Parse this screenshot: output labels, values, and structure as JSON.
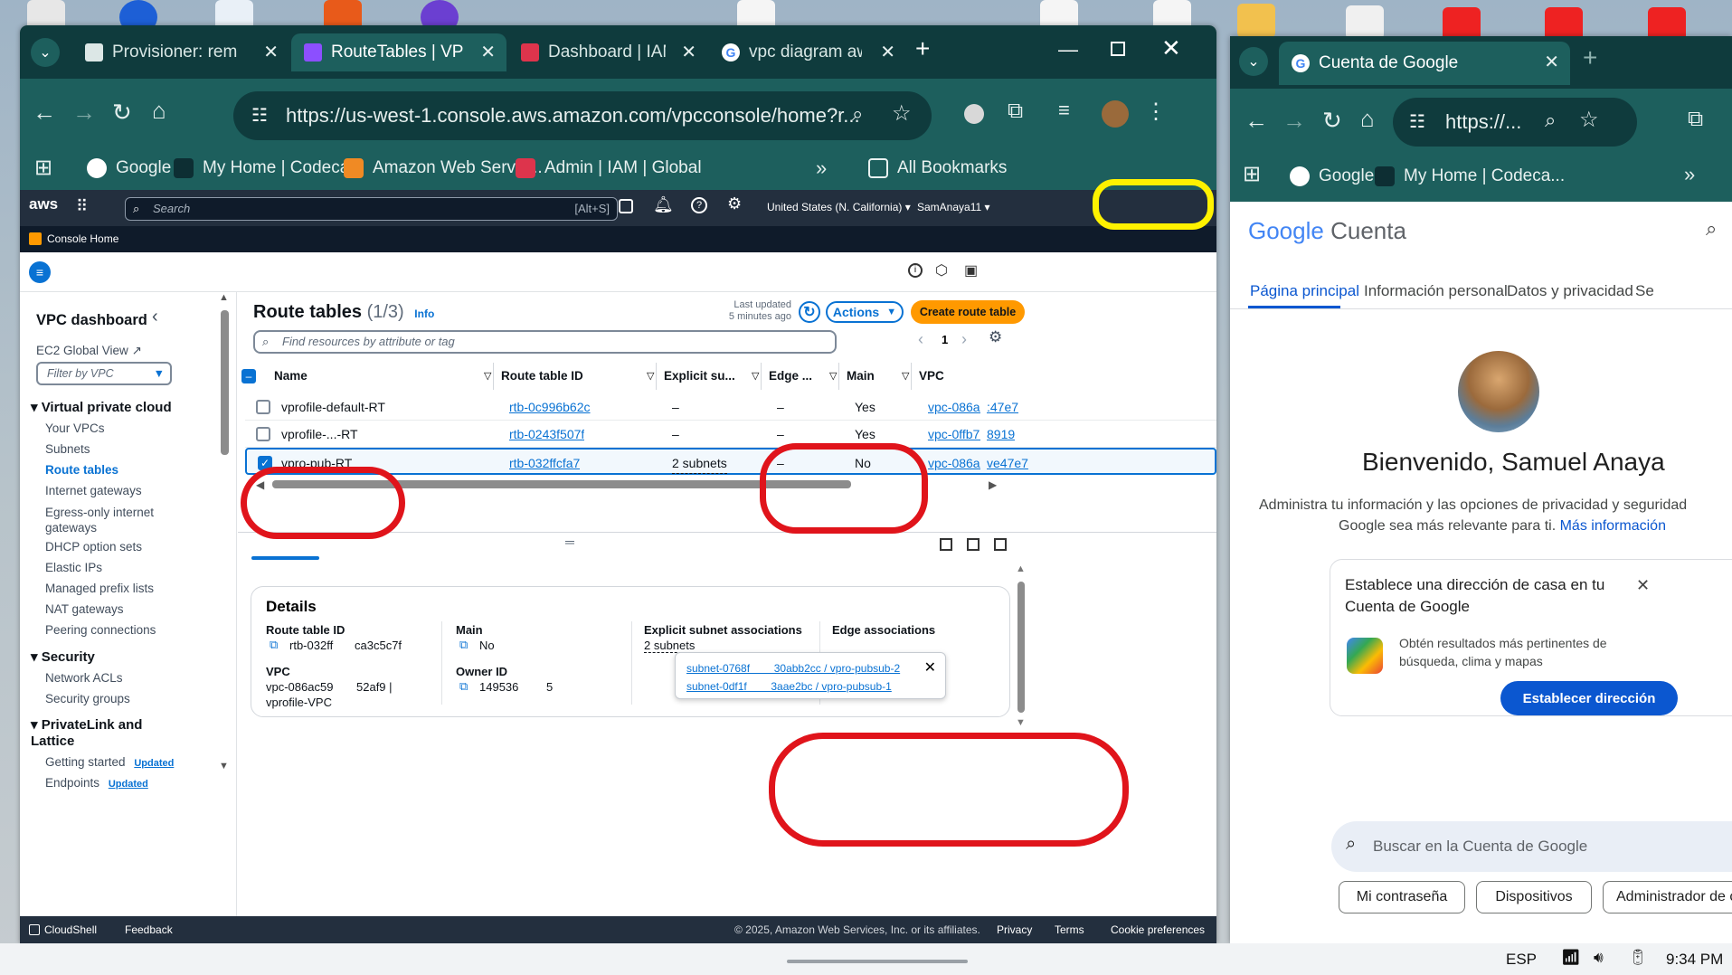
{
  "browser": {
    "tabs": [
      {
        "label": "Provisioner: rem"
      },
      {
        "label": "RouteTables | VP"
      },
      {
        "label": "Dashboard | IAM"
      },
      {
        "label": "vpc diagram aw"
      }
    ],
    "url": "https://us-west-1.console.aws.amazon.com/vpcconsole/home?r...",
    "bookmarks": [
      "Google",
      "My Home | Codeca...",
      "Amazon Web Servic...",
      "Admin | IAM | Global"
    ],
    "all_bookmarks": "All Bookmarks"
  },
  "aws": {
    "logo": "aws",
    "search_placeholder": "Search",
    "search_shortcut": "[Alt+S]",
    "region": "United States (N. California)",
    "user": "SamAnaya11",
    "console_home": "Console Home"
  },
  "sidebar": {
    "title": "VPC dashboard",
    "ec2_global": "EC2 Global View",
    "filter_placeholder": "Filter by VPC",
    "sections": [
      {
        "title": "Virtual private cloud",
        "items": [
          "Your VPCs",
          "Subnets",
          "Route tables",
          "Internet gateways",
          "Egress-only internet gateways",
          "DHCP option sets",
          "Elastic IPs",
          "Managed prefix lists",
          "NAT gateways",
          "Peering connections"
        ]
      },
      {
        "title": "Security",
        "items": [
          "Network ACLs",
          "Security groups"
        ]
      },
      {
        "title": "PrivateLink and Lattice",
        "items": [
          "Getting started",
          "Endpoints"
        ]
      }
    ],
    "updated_badge": "Updated"
  },
  "route_tables": {
    "title": "Route tables",
    "count": "(1/3)",
    "info": "Info",
    "last_updated": "Last updated",
    "last_updated_when": "5 minutes ago",
    "actions": "Actions",
    "create": "Create route table",
    "filter_placeholder": "Find resources by attribute or tag",
    "page": "1",
    "columns": [
      "Name",
      "Route table ID",
      "Explicit su...",
      "Edge ...",
      "Main",
      "VPC"
    ],
    "rows": [
      {
        "name": "vprofile-default-RT",
        "id": "rtb-0c996b62c",
        "explicit": "–",
        "edge": "–",
        "main": "Yes",
        "vpc": "vpc-086ac",
        "vpc2": ":47e7"
      },
      {
        "name": "vprofile-...-RT",
        "id": "rtb-0243f507f",
        "explicit": "–",
        "edge": "–",
        "main": "Yes",
        "vpc": "vpc-0ffb7e",
        "vpc2": "8919"
      },
      {
        "name": "vpro-pub-RT",
        "id": "rtb-032ffcfa7",
        "explicit": "2 subnets",
        "edge": "–",
        "main": "No",
        "vpc": "vpc-086ac",
        "vpc2": "ve47e7"
      }
    ]
  },
  "details": {
    "title": "Details",
    "route_table_id_label": "Route table ID",
    "route_table_id": "rtb-032ff",
    "route_table_id_tail": "ca3c5c7f",
    "main_label": "Main",
    "main": "No",
    "explicit_label": "Explicit subnet associations",
    "explicit": "2 subnets",
    "edge_label": "Edge associations",
    "vpc_label": "VPC",
    "vpc": "vpc-086ac59",
    "vpc_tail": "52af9 |",
    "vpc_name": "vprofile-VPC",
    "owner_label": "Owner ID",
    "owner": "149536",
    "owner_tail": "5"
  },
  "popup": {
    "items": [
      "subnet-0768f        30abb2cc / vpro-pubsub-2",
      "subnet-0df1f        3aae2bc / vpro-pubsub-1"
    ]
  },
  "footer": {
    "cloudshell": "CloudShell",
    "feedback": "Feedback",
    "copyright": "© 2025, Amazon Web Services, Inc. or its affiliates.",
    "privacy": "Privacy",
    "terms": "Terms",
    "cookies": "Cookie preferences"
  },
  "google_window": {
    "tab": "Cuenta de Google",
    "url": "https://...",
    "bookmarks": [
      "Google",
      "My Home | Codeca..."
    ],
    "brand": "Google",
    "brand_suffix": "Cuenta",
    "tabs": [
      "Página principal",
      "Información personal",
      "Datos y privacidad",
      "Se"
    ],
    "welcome": "Bienvenido, Samuel Anaya",
    "subtitle1": "Administra tu información y las opciones de privacidad y seguridad",
    "subtitle2": "Google sea más relevante para ti.",
    "more_info": "Más información",
    "card_title": "Establece una dirección de casa en tu Cuenta de Google",
    "card_text": "Obtén resultados más pertinentes de búsqueda, clima y mapas",
    "card_button": "Establecer dirección",
    "search_placeholder": "Buscar en la Cuenta de Google",
    "chips": [
      "Mi contraseña",
      "Dispositivos",
      "Administrador de contraseñas"
    ]
  },
  "taskbar": {
    "lang": "ESP",
    "time": "9:34 PM"
  },
  "colors": {
    "aws_orange": "#ff9900",
    "aws_blue": "#0972d3",
    "aws_nav": "#232f3e",
    "chrome_tab": "#0f3b3d",
    "chrome_active": "#1d5f5d",
    "annotation_red": "#e0141b",
    "annotation_yellow": "#fff200"
  }
}
